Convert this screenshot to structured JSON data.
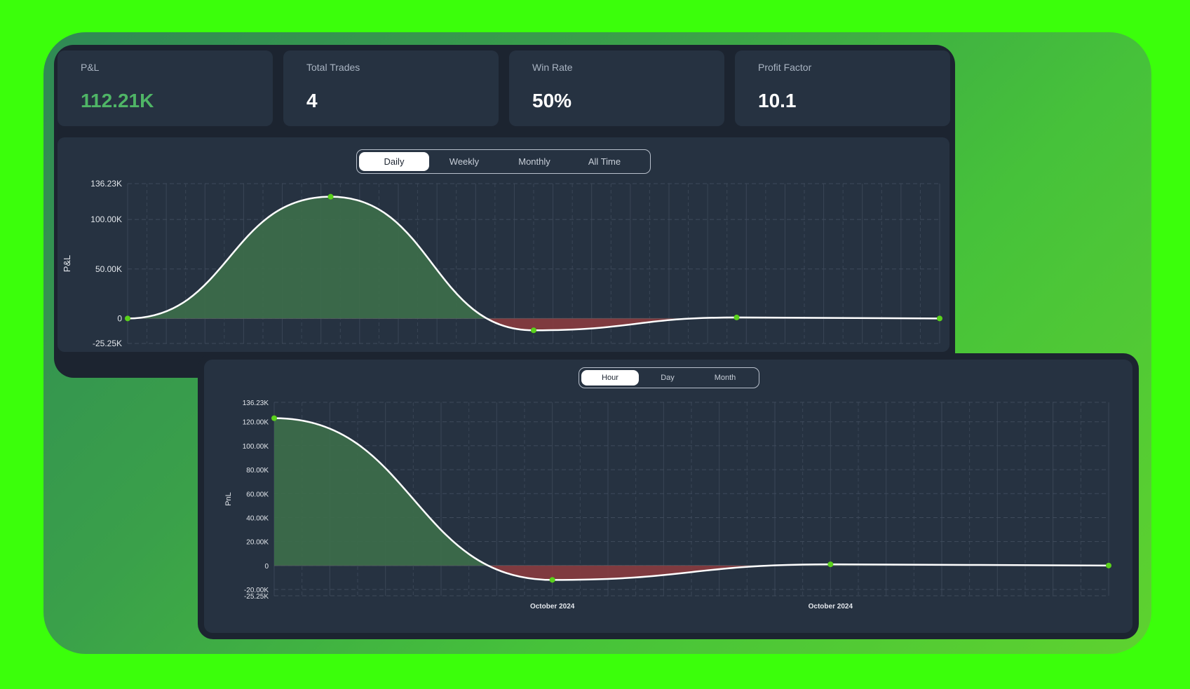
{
  "stats": [
    {
      "label": "P&L",
      "value": "112.21K"
    },
    {
      "label": "Total Trades",
      "value": "4"
    },
    {
      "label": "Win Rate",
      "value": "50%"
    },
    {
      "label": "Profit Factor",
      "value": "10.1"
    }
  ],
  "top_tabs": [
    "Daily",
    "Weekly",
    "Monthly",
    "All Time"
  ],
  "top_tabs_active": "Daily",
  "bottom_tabs": [
    "Hour",
    "Day",
    "Month"
  ],
  "bottom_tabs_active": "Hour",
  "colors": {
    "profit_fill": "#3d6e4a",
    "loss_fill": "#8a3b3f",
    "line": "#ffffff",
    "marker": "#5ad11c",
    "positive_text": "#4fb566"
  },
  "chart_data": [
    {
      "type": "area",
      "ylabel": "P&L",
      "xlabel": "",
      "ylim": [
        -25250,
        136230
      ],
      "yticks": [
        {
          "value": 136230,
          "label": "136.23K"
        },
        {
          "value": 100000,
          "label": "100.00K"
        },
        {
          "value": 50000,
          "label": "50.00K"
        },
        {
          "value": 0,
          "label": "0"
        },
        {
          "value": -25250,
          "label": "-25.25K"
        }
      ],
      "xlim": [
        0,
        4
      ],
      "points": [
        {
          "x": 0,
          "y": 0
        },
        {
          "x": 1,
          "y": 123000
        },
        {
          "x": 2,
          "y": -12000
        },
        {
          "x": 3,
          "y": 1000
        },
        {
          "x": 4,
          "y": 0
        }
      ],
      "grid": true
    },
    {
      "type": "area",
      "ylabel": "PnL",
      "xlabel": "",
      "ylim": [
        -25250,
        136230
      ],
      "yticks": [
        {
          "value": 136230,
          "label": "136.23K"
        },
        {
          "value": 120000,
          "label": "120.00K"
        },
        {
          "value": 100000,
          "label": "100.00K"
        },
        {
          "value": 80000,
          "label": "80.00K"
        },
        {
          "value": 60000,
          "label": "60.00K"
        },
        {
          "value": 40000,
          "label": "40.00K"
        },
        {
          "value": 20000,
          "label": "20.00K"
        },
        {
          "value": 0,
          "label": "0"
        },
        {
          "value": -20000,
          "label": "-20.00K"
        },
        {
          "value": -25250,
          "label": "-25.25K"
        }
      ],
      "xlim": [
        0,
        3
      ],
      "xticks": [
        {
          "x": 1,
          "label": "October 2024"
        },
        {
          "x": 2,
          "label": "October 2024"
        }
      ],
      "points": [
        {
          "x": 0,
          "y": 123000
        },
        {
          "x": 1,
          "y": -12000
        },
        {
          "x": 2,
          "y": 1000
        },
        {
          "x": 3,
          "y": 0
        }
      ],
      "grid": true
    }
  ]
}
